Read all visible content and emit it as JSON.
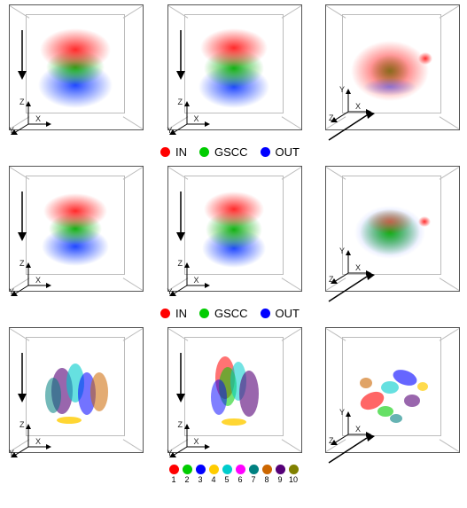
{
  "chart_data": {
    "type": "scatter",
    "description": "3x3 grid of 3D scatter-plot panels showing network bow-tie component embedding (rows 1-2) and community embedding (row 3) from three viewing angles.",
    "rows": [
      {
        "legend": {
          "kind": "categories",
          "items": [
            {
              "name": "IN",
              "color": "#ff0000"
            },
            {
              "name": "GSCC",
              "color": "#00cc00"
            },
            {
              "name": "OUT",
              "color": "#0000ff"
            }
          ]
        },
        "panels": [
          {
            "view": "front-XZ",
            "arrow": "down",
            "axes_order": [
              "Z",
              "X",
              "Y"
            ],
            "layers_top_to_bottom": [
              "IN",
              "GSCC",
              "OUT"
            ]
          },
          {
            "view": "front-XZ",
            "arrow": "down",
            "axes_order": [
              "Z",
              "X",
              "Y"
            ],
            "layers_top_to_bottom": [
              "IN",
              "GSCC",
              "OUT"
            ]
          },
          {
            "view": "top-XY",
            "arrow": "diag-up",
            "axes_order": [
              "Y",
              "X",
              "Z"
            ],
            "dominant": "IN",
            "notes": "mostly red with green/blue speckle, small satellite blob upper-right"
          }
        ]
      },
      {
        "legend": {
          "kind": "categories",
          "items": [
            {
              "name": "IN",
              "color": "#ff0000"
            },
            {
              "name": "GSCC",
              "color": "#00cc00"
            },
            {
              "name": "OUT",
              "color": "#0000ff"
            }
          ]
        },
        "panels": [
          {
            "view": "front-XZ",
            "arrow": "down",
            "axes_order": [
              "Z",
              "X",
              "Y"
            ],
            "layers_top_to_bottom": [
              "IN",
              "GSCC",
              "OUT"
            ]
          },
          {
            "view": "front-XZ",
            "arrow": "down",
            "axes_order": [
              "Z",
              "X",
              "Y"
            ],
            "layers_top_to_bottom": [
              "IN",
              "GSCC",
              "OUT"
            ]
          },
          {
            "view": "top-XY",
            "arrow": "diag-up",
            "axes_order": [
              "Y",
              "X",
              "Z"
            ],
            "dominant": "GSCC",
            "notes": "green core with red/blue speckle, small satellite"
          }
        ]
      },
      {
        "legend": {
          "kind": "numbered",
          "colors": [
            "#ff0000",
            "#00cc00",
            "#0000ff",
            "#ffcc00",
            "#00cccc",
            "#ff00ff",
            "#008080",
            "#cc6600",
            "#550077",
            "#808000"
          ],
          "labels": [
            "1",
            "2",
            "3",
            "4",
            "5",
            "6",
            "7",
            "8",
            "9",
            "10"
          ]
        },
        "panels": [
          {
            "view": "front-XZ",
            "arrow": "down",
            "axes_order": [
              "Z",
              "X",
              "Y"
            ],
            "notes": "several elongated colored sub-clouds"
          },
          {
            "view": "front-XZ",
            "arrow": "down",
            "axes_order": [
              "Z",
              "X",
              "Y"
            ],
            "notes": "several elongated colored sub-clouds"
          },
          {
            "view": "top-XY",
            "arrow": "diag-up",
            "axes_order": [
              "Y",
              "X",
              "Z"
            ],
            "notes": "scattered distinct colored clusters"
          }
        ]
      }
    ]
  },
  "labels": {
    "axes": {
      "x": "X",
      "y": "Y",
      "z": "Z"
    },
    "row01_legend": {
      "in": "IN",
      "gscc": "GSCC",
      "out": "OUT"
    }
  }
}
